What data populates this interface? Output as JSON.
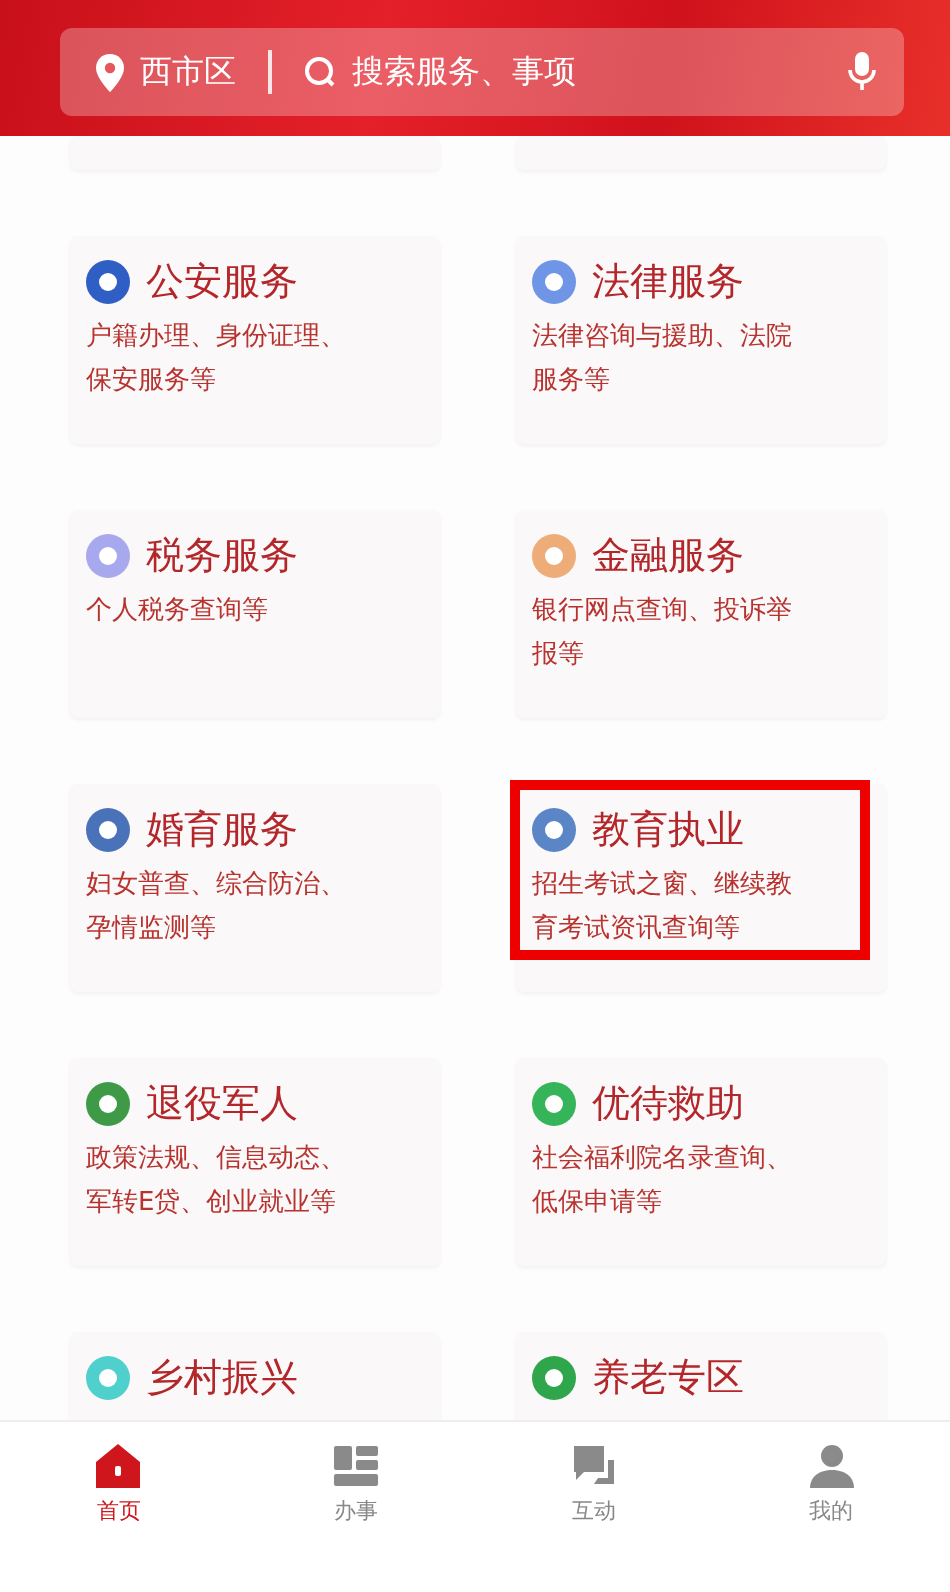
{
  "search_bar": {
    "location": "西市区",
    "placeholder": "搜索服务、事项"
  },
  "services": [
    {
      "title": "公安服务",
      "description": "户籍办理、身份证理、保安服务等",
      "color": "#2f5fc4",
      "highlighted": false
    },
    {
      "title": "法律服务",
      "description": "法律咨询与援助、法院服务等",
      "color": "#6f95e6",
      "highlighted": false
    },
    {
      "title": "税务服务",
      "description": "个人税务查询等",
      "color": "#a7a8ee",
      "highlighted": false
    },
    {
      "title": "金融服务",
      "description": "银行网点查询、投诉举报等",
      "color": "#eeac78",
      "highlighted": false
    },
    {
      "title": "婚育服务",
      "description": "妇女普查、综合防治、孕情监测等",
      "color": "#4a72b8",
      "highlighted": false
    },
    {
      "title": "教育执业",
      "description": "招生考试之窗、继续教育考试资讯查询等",
      "color": "#5a86c8",
      "highlighted": true
    },
    {
      "title": "退役军人",
      "description": "政策法规、信息动态、军转E贷、创业就业等",
      "color": "#3f9a48",
      "highlighted": false
    },
    {
      "title": "优待救助",
      "description": "社会福利院名录查询、低保申请等",
      "color": "#35b45a",
      "highlighted": false
    },
    {
      "title": "乡村振兴",
      "color": "#4fd0cc",
      "highlighted": false
    },
    {
      "title": "养老专区",
      "color": "#2fa64c",
      "highlighted": false
    }
  ],
  "tab_bar": [
    {
      "label": "首页",
      "kind": "home",
      "selected": true
    },
    {
      "label": "办事",
      "kind": "tasks",
      "selected": false
    },
    {
      "label": "互动",
      "kind": "chat",
      "selected": false
    },
    {
      "label": "我的",
      "kind": "profile",
      "selected": false
    }
  ]
}
